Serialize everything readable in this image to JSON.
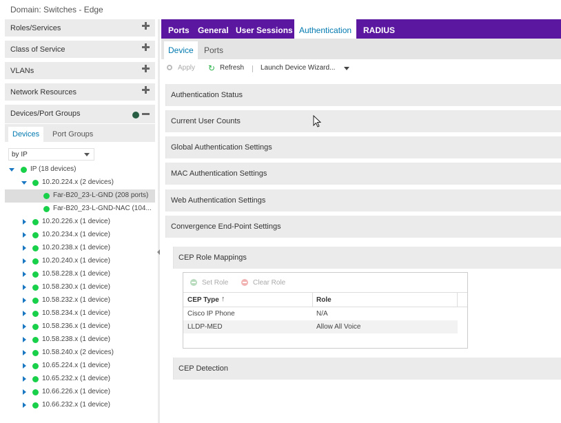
{
  "window": {
    "title": "Domain: Switches - Edge"
  },
  "left_panel": {
    "sections": [
      {
        "label": "Roles/Services"
      },
      {
        "label": "Class of Service"
      },
      {
        "label": "VLANs"
      },
      {
        "label": "Network Resources"
      }
    ],
    "devices_section": {
      "label": "Devices/Port Groups"
    },
    "subtabs": [
      "Devices",
      "Port Groups"
    ],
    "filter_select": {
      "value": "by IP"
    },
    "tree": [
      {
        "label": "IP (18 devices)",
        "level": 0,
        "expanded": true
      },
      {
        "label": "10.20.224.x (2 devices)",
        "level": 1,
        "expanded": true
      },
      {
        "label": "Far-B20_23-L-GND (208 ports)",
        "level": 2,
        "selected": true
      },
      {
        "label": "Far-B20_23-L-GND-NAC (104...",
        "level": 2
      },
      {
        "label": "10.20.226.x (1 device)",
        "level": 1
      },
      {
        "label": "10.20.234.x (1 device)",
        "level": 1
      },
      {
        "label": "10.20.238.x (1 device)",
        "level": 1
      },
      {
        "label": "10.20.240.x (1 device)",
        "level": 1
      },
      {
        "label": "10.58.228.x (1 device)",
        "level": 1
      },
      {
        "label": "10.58.230.x (1 device)",
        "level": 1
      },
      {
        "label": "10.58.232.x (1 device)",
        "level": 1
      },
      {
        "label": "10.58.234.x (1 device)",
        "level": 1
      },
      {
        "label": "10.58.236.x (1 device)",
        "level": 1
      },
      {
        "label": "10.58.238.x (1 device)",
        "level": 1
      },
      {
        "label": "10.58.240.x (2 devices)",
        "level": 1
      },
      {
        "label": "10.65.224.x (1 device)",
        "level": 1
      },
      {
        "label": "10.65.232.x (1 device)",
        "level": 1
      },
      {
        "label": "10.66.226.x (1 device)",
        "level": 1
      },
      {
        "label": "10.66.232.x (1 device)",
        "level": 1
      }
    ]
  },
  "top_tabs": [
    "Ports",
    "General",
    "User Sessions",
    "Authentication",
    "RADIUS"
  ],
  "sub_tabs": [
    "Device",
    "Ports"
  ],
  "toolbar": {
    "apply": "Apply",
    "refresh": "Refresh",
    "wizard": "Launch Device Wizard..."
  },
  "sections": [
    "Authentication Status",
    "Current User Counts",
    "Global Authentication Settings",
    "MAC Authentication Settings",
    "Web Authentication Settings",
    "Convergence End-Point Settings"
  ],
  "cep_role_mappings": {
    "title": "CEP Role Mappings",
    "set_role": "Set Role",
    "clear_role": "Clear Role",
    "columns": [
      "CEP Type",
      "Role"
    ],
    "rows": [
      [
        "Cisco IP Phone",
        "N/A"
      ],
      [
        "LLDP-MED",
        "Allow All Voice"
      ]
    ]
  },
  "cep_detection": {
    "title": "CEP Detection"
  },
  "colors": {
    "nav_purple": "#5c17a0",
    "active_blue": "#0079b0",
    "status_green": "#19d04a"
  }
}
